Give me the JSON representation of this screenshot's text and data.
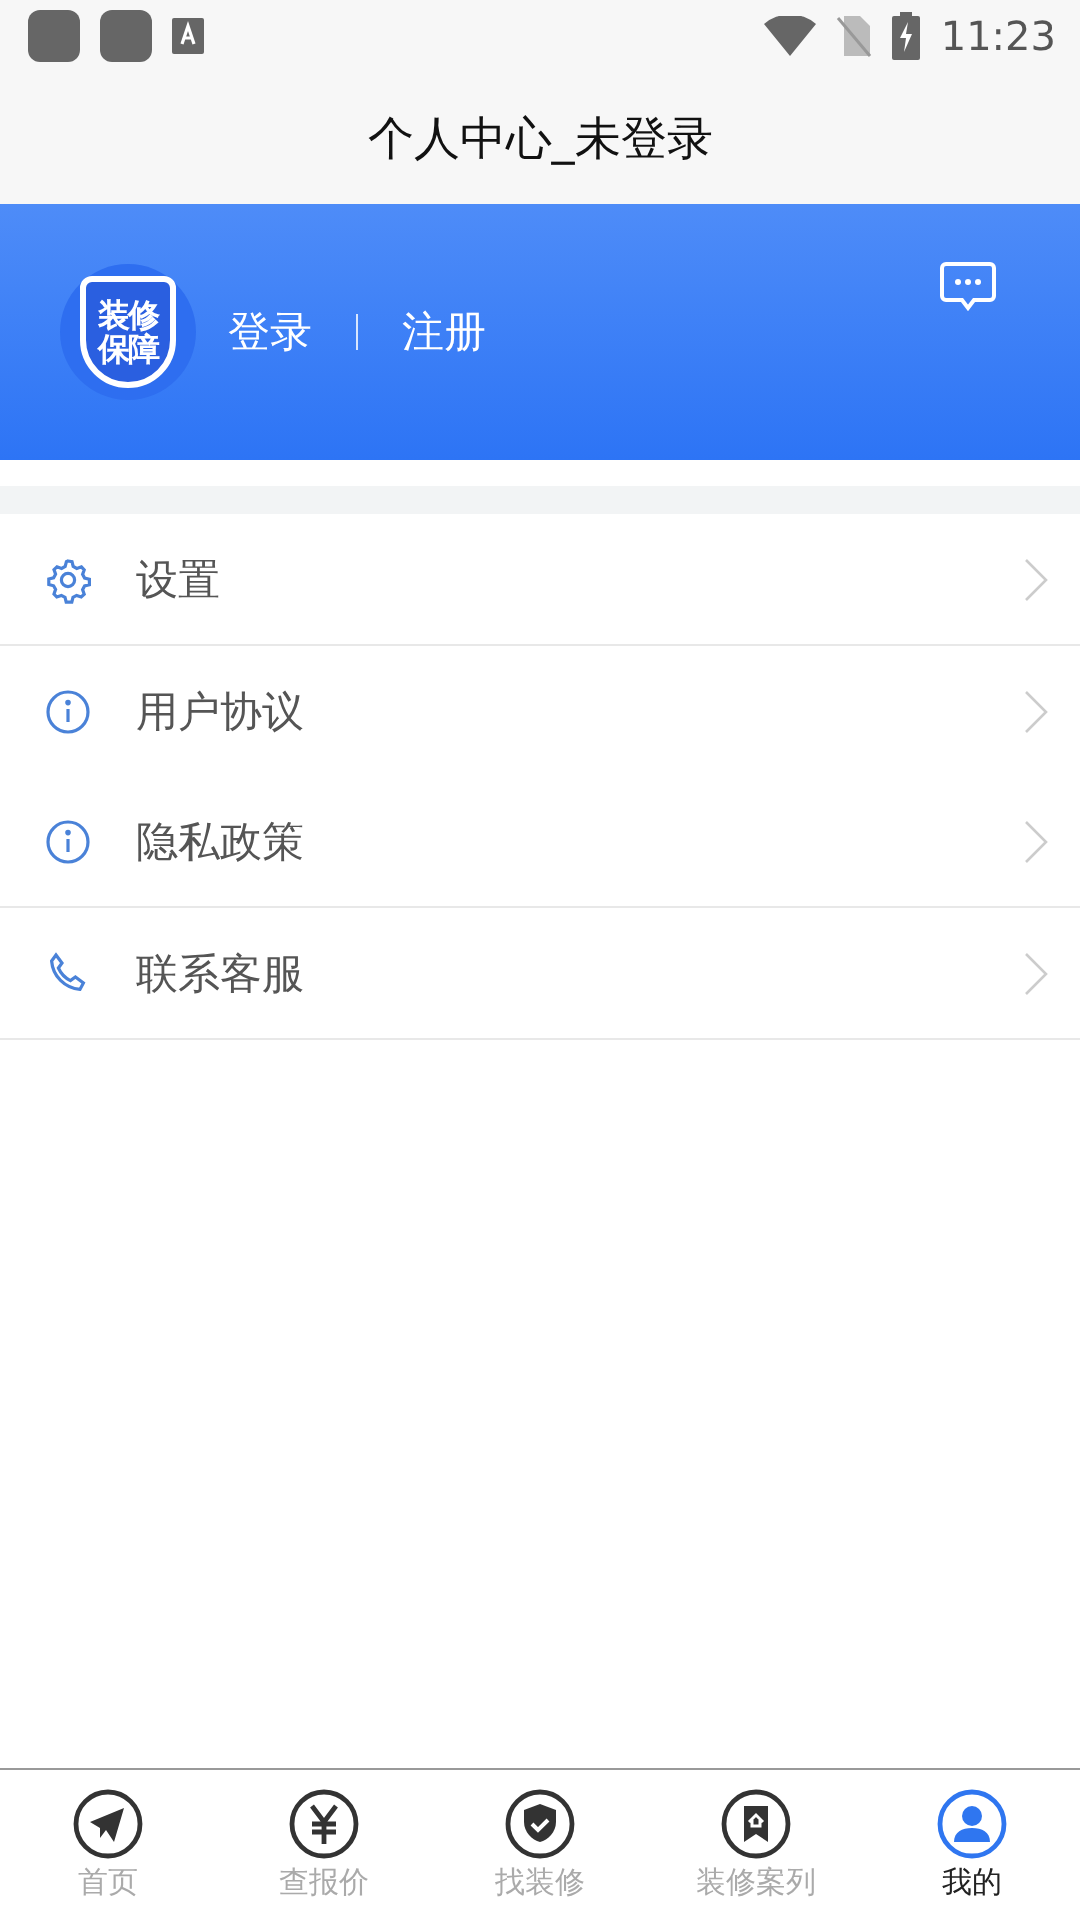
{
  "status_bar": {
    "time": "11:23"
  },
  "title": "个人中心_未登录",
  "header": {
    "logo_lines": [
      "装修",
      "保障"
    ],
    "login": "登录",
    "register": "注册"
  },
  "menu_groups": [
    [
      {
        "label": "设置",
        "kind": "gear"
      }
    ],
    [
      {
        "label": "用户协议",
        "kind": "info"
      },
      {
        "label": "隐私政策",
        "kind": "info"
      }
    ],
    [
      {
        "label": "联系客服",
        "kind": "phone"
      }
    ]
  ],
  "tabs": [
    {
      "label": "首页",
      "kind": "plane",
      "selected": false
    },
    {
      "label": "查报价",
      "kind": "yen",
      "selected": false
    },
    {
      "label": "找装修",
      "kind": "shield",
      "selected": false
    },
    {
      "label": "装修案列",
      "kind": "bookmark",
      "selected": false
    },
    {
      "label": "我的",
      "kind": "person",
      "selected": true
    }
  ]
}
